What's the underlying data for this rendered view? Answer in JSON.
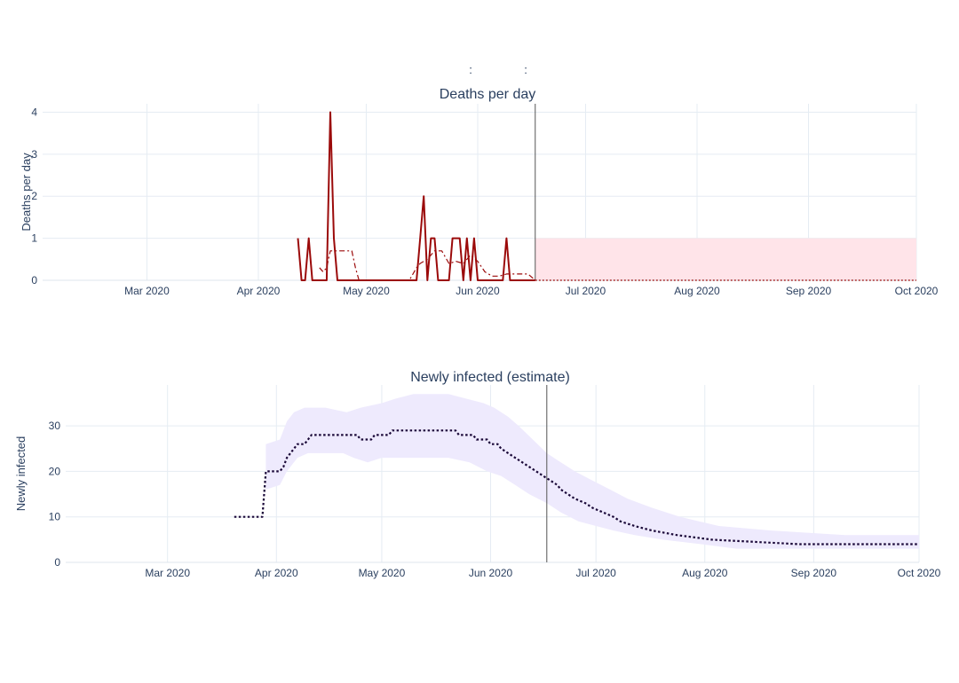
{
  "header": {
    "separator_1": ":",
    "separator_2": ":"
  },
  "colors": {
    "death_line": "#9b0a0a",
    "death_avg": "#9b0a0a",
    "pred_band": "#ffe4e9",
    "infected_line": "#1a0838",
    "infected_band": "#eeeafd",
    "today_line": "#555555"
  },
  "chart_data": [
    {
      "type": "line",
      "title": "Deaths per day",
      "ylabel": "Deaths per day",
      "xlabel": "",
      "xlim": [
        "2020-02-01",
        "2020-10-01"
      ],
      "ylim": [
        0,
        4.2
      ],
      "x_ticks": [
        {
          "x": "2020-03-01",
          "label": "Mar 2020"
        },
        {
          "x": "2020-04-01",
          "label": "Apr 2020"
        },
        {
          "x": "2020-05-01",
          "label": "May 2020"
        },
        {
          "x": "2020-06-01",
          "label": "Jun 2020"
        },
        {
          "x": "2020-07-01",
          "label": "Jul 2020"
        },
        {
          "x": "2020-08-01",
          "label": "Aug 2020"
        },
        {
          "x": "2020-09-01",
          "label": "Sep 2020"
        },
        {
          "x": "2020-10-01",
          "label": "Oct 2020"
        }
      ],
      "y_ticks": [
        0,
        1,
        2,
        3,
        4
      ],
      "grid": true,
      "today_marker": "2020-06-17",
      "series": [
        {
          "style": "solid",
          "points": [
            [
              "2020-04-12",
              1
            ],
            [
              "2020-04-13",
              0
            ],
            [
              "2020-04-14",
              0
            ],
            [
              "2020-04-15",
              1
            ],
            [
              "2020-04-16",
              0
            ],
            [
              "2020-04-17",
              0
            ],
            [
              "2020-04-18",
              0
            ],
            [
              "2020-04-19",
              0
            ],
            [
              "2020-04-20",
              0
            ],
            [
              "2020-04-21",
              4
            ],
            [
              "2020-04-22",
              1
            ],
            [
              "2020-04-23",
              0
            ],
            [
              "2020-04-24",
              0
            ],
            [
              "2020-04-25",
              0
            ],
            [
              "2020-04-26",
              0
            ],
            [
              "2020-05-15",
              0
            ],
            [
              "2020-05-16",
              1
            ],
            [
              "2020-05-17",
              2
            ],
            [
              "2020-05-18",
              0
            ],
            [
              "2020-05-19",
              1
            ],
            [
              "2020-05-20",
              1
            ],
            [
              "2020-05-21",
              0
            ],
            [
              "2020-05-22",
              0
            ],
            [
              "2020-05-23",
              0
            ],
            [
              "2020-05-24",
              0
            ],
            [
              "2020-05-25",
              1
            ],
            [
              "2020-05-26",
              1
            ],
            [
              "2020-05-27",
              1
            ],
            [
              "2020-05-28",
              0
            ],
            [
              "2020-05-29",
              1
            ],
            [
              "2020-05-30",
              0
            ],
            [
              "2020-05-31",
              1
            ],
            [
              "2020-06-01",
              0
            ],
            [
              "2020-06-02",
              0
            ],
            [
              "2020-06-03",
              0
            ],
            [
              "2020-06-04",
              0
            ],
            [
              "2020-06-05",
              0
            ],
            [
              "2020-06-06",
              0
            ],
            [
              "2020-06-07",
              0
            ],
            [
              "2020-06-08",
              0
            ],
            [
              "2020-06-09",
              1
            ],
            [
              "2020-06-10",
              0
            ],
            [
              "2020-06-11",
              0
            ],
            [
              "2020-06-12",
              0
            ],
            [
              "2020-06-13",
              0
            ],
            [
              "2020-06-14",
              0
            ],
            [
              "2020-06-15",
              0
            ],
            [
              "2020-06-16",
              0
            ],
            [
              "2020-06-17",
              0
            ]
          ]
        },
        {
          "style": "dashdot",
          "points": [
            [
              "2020-04-18",
              0.3
            ],
            [
              "2020-04-19",
              0.2
            ],
            [
              "2020-04-20",
              0.3
            ],
            [
              "2020-04-21",
              0.7
            ],
            [
              "2020-04-24",
              0.7
            ],
            [
              "2020-04-27",
              0.7
            ],
            [
              "2020-04-28",
              0.3
            ],
            [
              "2020-04-29",
              0
            ],
            [
              "2020-05-13",
              0
            ],
            [
              "2020-05-15",
              0.3
            ],
            [
              "2020-05-16",
              0.4
            ],
            [
              "2020-05-18",
              0.5
            ],
            [
              "2020-05-20",
              0.7
            ],
            [
              "2020-05-22",
              0.7
            ],
            [
              "2020-05-24",
              0.4
            ],
            [
              "2020-05-26",
              0.45
            ],
            [
              "2020-05-28",
              0.4
            ],
            [
              "2020-05-30",
              0.6
            ],
            [
              "2020-06-01",
              0.45
            ],
            [
              "2020-06-03",
              0.2
            ],
            [
              "2020-06-05",
              0.1
            ],
            [
              "2020-06-07",
              0.1
            ],
            [
              "2020-06-09",
              0.15
            ],
            [
              "2020-06-15",
              0.15
            ],
            [
              "2020-06-17",
              0
            ]
          ]
        },
        {
          "style": "dotted",
          "points": [
            [
              "2020-06-17",
              0
            ],
            [
              "2020-10-01",
              0
            ]
          ]
        }
      ],
      "bands": [
        {
          "upper": [
            [
              "2020-06-17",
              1
            ],
            [
              "2020-10-01",
              1
            ]
          ],
          "lower": [
            [
              "2020-06-17",
              0
            ],
            [
              "2020-10-01",
              0
            ]
          ]
        }
      ]
    },
    {
      "type": "line",
      "title": "Newly infected (estimate)",
      "ylabel": "Newly infected",
      "xlabel": "",
      "xlim": [
        "2020-02-01",
        "2020-10-01"
      ],
      "ylim": [
        0,
        39
      ],
      "x_ticks": [
        {
          "x": "2020-03-01",
          "label": "Mar 2020"
        },
        {
          "x": "2020-04-01",
          "label": "Apr 2020"
        },
        {
          "x": "2020-05-01",
          "label": "May 2020"
        },
        {
          "x": "2020-06-01",
          "label": "Jun 2020"
        },
        {
          "x": "2020-07-01",
          "label": "Jul 2020"
        },
        {
          "x": "2020-08-01",
          "label": "Aug 2020"
        },
        {
          "x": "2020-09-01",
          "label": "Sep 2020"
        },
        {
          "x": "2020-10-01",
          "label": "Oct 2020"
        }
      ],
      "y_ticks": [
        0,
        10,
        20,
        30
      ],
      "grid": true,
      "today_marker": "2020-06-17",
      "series": [
        {
          "style": "dotted-step",
          "points": [
            [
              "2020-03-20",
              10
            ],
            [
              "2020-03-28",
              10
            ],
            [
              "2020-03-29",
              20
            ],
            [
              "2020-04-02",
              20
            ],
            [
              "2020-04-03",
              21
            ],
            [
              "2020-04-04",
              23
            ],
            [
              "2020-04-05",
              24
            ],
            [
              "2020-04-06",
              25
            ],
            [
              "2020-04-07",
              26
            ],
            [
              "2020-04-09",
              26
            ],
            [
              "2020-04-10",
              27
            ],
            [
              "2020-04-11",
              28
            ],
            [
              "2020-04-24",
              28
            ],
            [
              "2020-04-25",
              27
            ],
            [
              "2020-04-28",
              27
            ],
            [
              "2020-04-29",
              28
            ],
            [
              "2020-05-03",
              28
            ],
            [
              "2020-05-04",
              29
            ],
            [
              "2020-05-22",
              29
            ],
            [
              "2020-05-23",
              28
            ],
            [
              "2020-05-27",
              28
            ],
            [
              "2020-05-28",
              27
            ],
            [
              "2020-05-31",
              27
            ],
            [
              "2020-06-01",
              26
            ],
            [
              "2020-06-03",
              26
            ],
            [
              "2020-06-04",
              25
            ],
            [
              "2020-06-06",
              24
            ],
            [
              "2020-06-08",
              23
            ],
            [
              "2020-06-10",
              22
            ],
            [
              "2020-06-12",
              21
            ],
            [
              "2020-06-14",
              20
            ],
            [
              "2020-06-16",
              19
            ],
            [
              "2020-06-18",
              18
            ],
            [
              "2020-06-20",
              17
            ],
            [
              "2020-06-21",
              16
            ],
            [
              "2020-06-23",
              15
            ],
            [
              "2020-06-25",
              14
            ],
            [
              "2020-06-28",
              13
            ],
            [
              "2020-06-30",
              12
            ],
            [
              "2020-07-03",
              11
            ],
            [
              "2020-07-06",
              10
            ],
            [
              "2020-07-08",
              9
            ],
            [
              "2020-07-12",
              8
            ],
            [
              "2020-07-17",
              7
            ],
            [
              "2020-07-24",
              6
            ],
            [
              "2020-08-03",
              5
            ],
            [
              "2020-08-28",
              4
            ],
            [
              "2020-10-01",
              4
            ]
          ]
        }
      ],
      "bands": [
        {
          "upper": [
            [
              "2020-03-29",
              26
            ],
            [
              "2020-04-02",
              27
            ],
            [
              "2020-04-04",
              31
            ],
            [
              "2020-04-06",
              33
            ],
            [
              "2020-04-09",
              34
            ],
            [
              "2020-04-15",
              34
            ],
            [
              "2020-04-21",
              33
            ],
            [
              "2020-04-25",
              34
            ],
            [
              "2020-05-01",
              35
            ],
            [
              "2020-05-05",
              36
            ],
            [
              "2020-05-10",
              37
            ],
            [
              "2020-05-20",
              37
            ],
            [
              "2020-05-25",
              36
            ],
            [
              "2020-05-30",
              35
            ],
            [
              "2020-06-02",
              34
            ],
            [
              "2020-06-06",
              32
            ],
            [
              "2020-06-09",
              30
            ],
            [
              "2020-06-13",
              27
            ],
            [
              "2020-06-17",
              24
            ],
            [
              "2020-06-21",
              22
            ],
            [
              "2020-06-25",
              20
            ],
            [
              "2020-06-30",
              18
            ],
            [
              "2020-07-05",
              16
            ],
            [
              "2020-07-10",
              14
            ],
            [
              "2020-07-17",
              12
            ],
            [
              "2020-07-25",
              10
            ],
            [
              "2020-08-05",
              8
            ],
            [
              "2020-08-20",
              7
            ],
            [
              "2020-09-10",
              6
            ],
            [
              "2020-10-01",
              6
            ]
          ],
          "lower": [
            [
              "2020-03-29",
              16
            ],
            [
              "2020-04-02",
              17
            ],
            [
              "2020-04-04",
              20
            ],
            [
              "2020-04-07",
              23
            ],
            [
              "2020-04-10",
              24
            ],
            [
              "2020-04-20",
              24
            ],
            [
              "2020-04-23",
              23
            ],
            [
              "2020-04-27",
              22
            ],
            [
              "2020-05-01",
              23
            ],
            [
              "2020-05-20",
              23
            ],
            [
              "2020-05-26",
              22
            ],
            [
              "2020-05-31",
              20
            ],
            [
              "2020-06-04",
              19
            ],
            [
              "2020-06-08",
              17
            ],
            [
              "2020-06-12",
              15
            ],
            [
              "2020-06-17",
              13
            ],
            [
              "2020-06-21",
              11
            ],
            [
              "2020-06-26",
              9
            ],
            [
              "2020-07-01",
              8
            ],
            [
              "2020-07-06",
              7
            ],
            [
              "2020-07-12",
              6
            ],
            [
              "2020-07-20",
              5
            ],
            [
              "2020-07-31",
              4
            ],
            [
              "2020-08-10",
              3
            ],
            [
              "2020-10-01",
              3
            ]
          ]
        }
      ]
    }
  ]
}
